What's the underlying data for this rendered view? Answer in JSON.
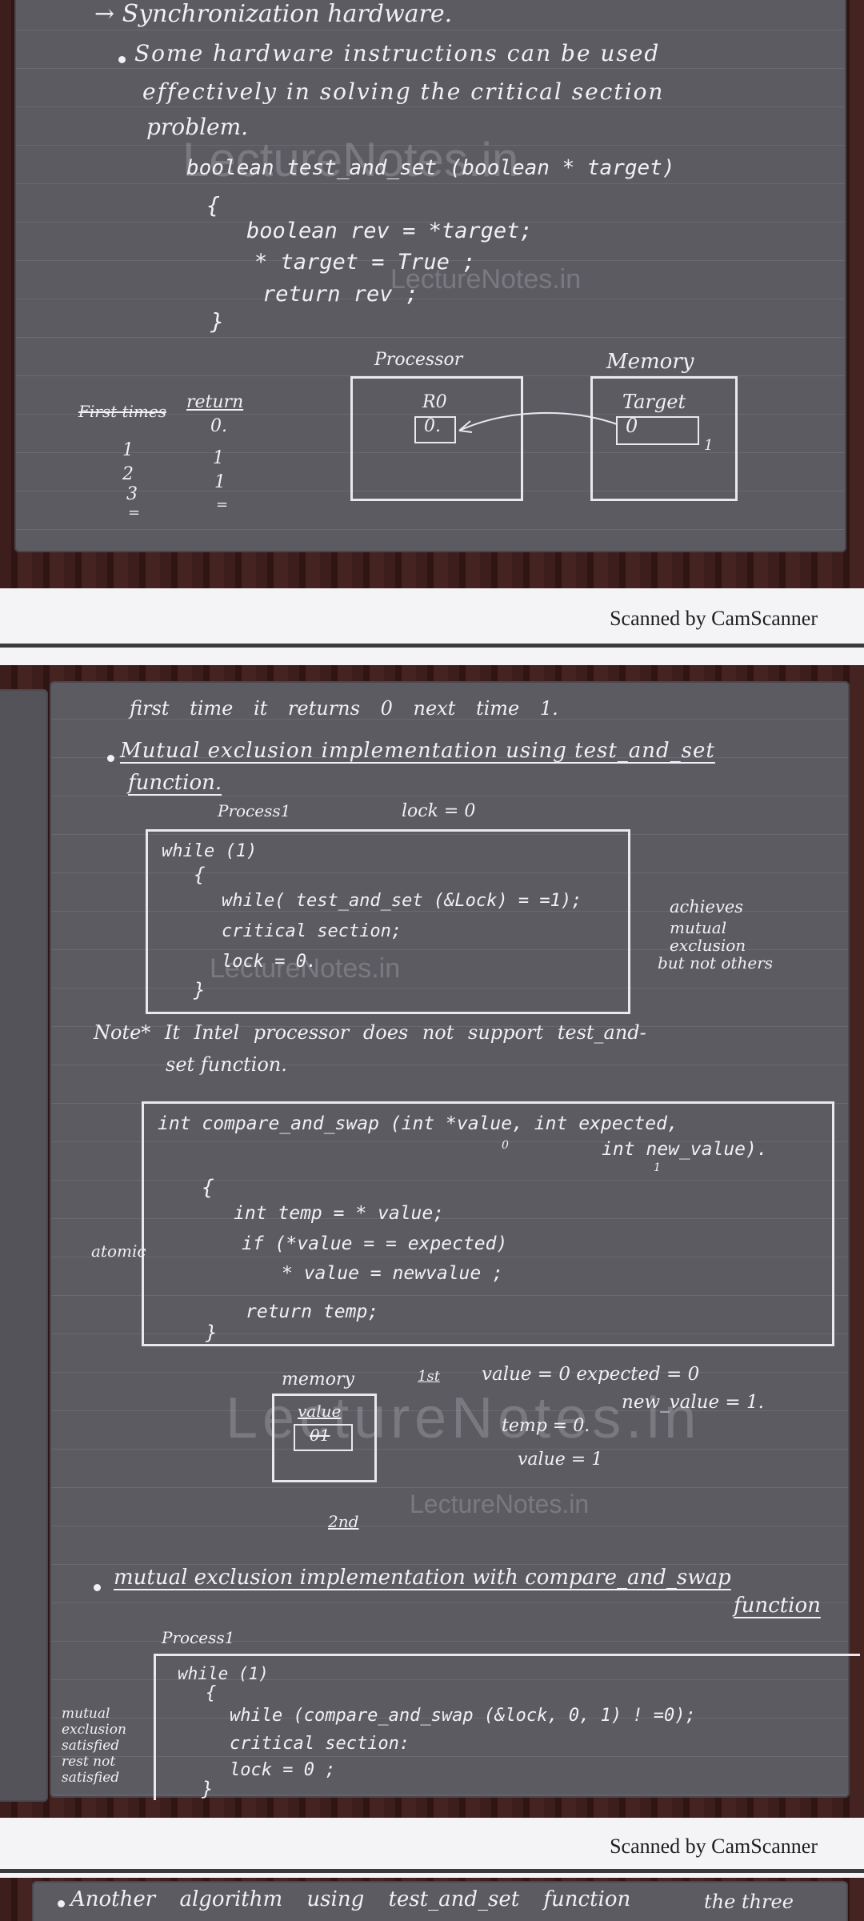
{
  "scan1": {
    "heading": "→ Synchronization hardware.",
    "bullet_text": [
      "Some hardware instructions can be used",
      "effectively in solving the critical section",
      "problem."
    ],
    "code_lines": [
      "boolean test_and_set (boolean * target)",
      "{",
      "boolean rev = *target;",
      "* target = True ;",
      "return rev ;",
      "}"
    ],
    "times_header": "First times",
    "return_header": "return",
    "times_values": [
      "1",
      "2",
      "3",
      "="
    ],
    "return_values": [
      "0.",
      "1",
      "1",
      "="
    ],
    "processor_label": "Processor",
    "memory_label": "Memory",
    "register_label": "R0",
    "register_value": "0.",
    "target_label": "Target",
    "target_value": "0",
    "target_new_value": "1",
    "watermark_1": "LectureNotes.in",
    "watermark_2": "LectureNotes.in"
  },
  "credit_1": "Scanned by CamScanner",
  "scan2": {
    "line_first": "first time it returns 0  next time 1.",
    "mutex_title_1": "Mutual exclusion implementation using test_and_set",
    "mutex_title_2": "function.",
    "process_label": "Process1",
    "lock_init": "lock = 0",
    "box1_lines": [
      "while (1)",
      "{",
      "while( test_and_set (&Lock) = =1);",
      "critical section;",
      "lock = 0.",
      "}"
    ],
    "side_note": [
      "achieves",
      "mutual",
      "exclusion",
      "but not others"
    ],
    "note_line_1": "Note* It  Intel processor does not support test_and-",
    "note_line_2": "set function.",
    "cas_signature_1": "int compare_and_swap (int *value, int expected,",
    "cas_signature_2": "int new_value).",
    "cas_anno_zero": "0",
    "cas_anno_one": "1",
    "cas_body": [
      "{",
      "int temp = * value;",
      "if (*value = = expected)",
      "* value = newvalue ;",
      "return temp;",
      "}"
    ],
    "atomic_label": "atomic",
    "memory_label": "memory",
    "value_label": "value",
    "value_cell": "01",
    "first_marker": "1st",
    "eval_lines": [
      "value = 0   expected = 0",
      "new_value = 1.",
      "temp = 0.",
      "value = 1"
    ],
    "second_marker": "2nd",
    "cas_title_1": "mutual exclusion implementation with compare_and_swap",
    "cas_title_2": "function",
    "process2_label": "Process1",
    "box2_lines": [
      "while (1)",
      "{",
      "while (compare_and_swap (&lock, 0, 1) ! =0);",
      "critical section:",
      "lock = 0 ;",
      "}"
    ],
    "side_note_2": [
      "mutual",
      "exclusion",
      "satisfied",
      "rest not",
      "satisfied"
    ],
    "watermark_1": "LectureNotes.in",
    "watermark_2": "LectureNotes.in",
    "watermark_3": "LectureNotes.in"
  },
  "credit_2": "Scanned by CamScanner",
  "scan3": {
    "line": "Another algorithm using test_and_set function",
    "line_tail": "the three"
  },
  "colors": {
    "paper": "#5d5b62",
    "ink": "#f1f0f6",
    "wood": "#3a1c1c",
    "band": "#f4f4f6"
  }
}
